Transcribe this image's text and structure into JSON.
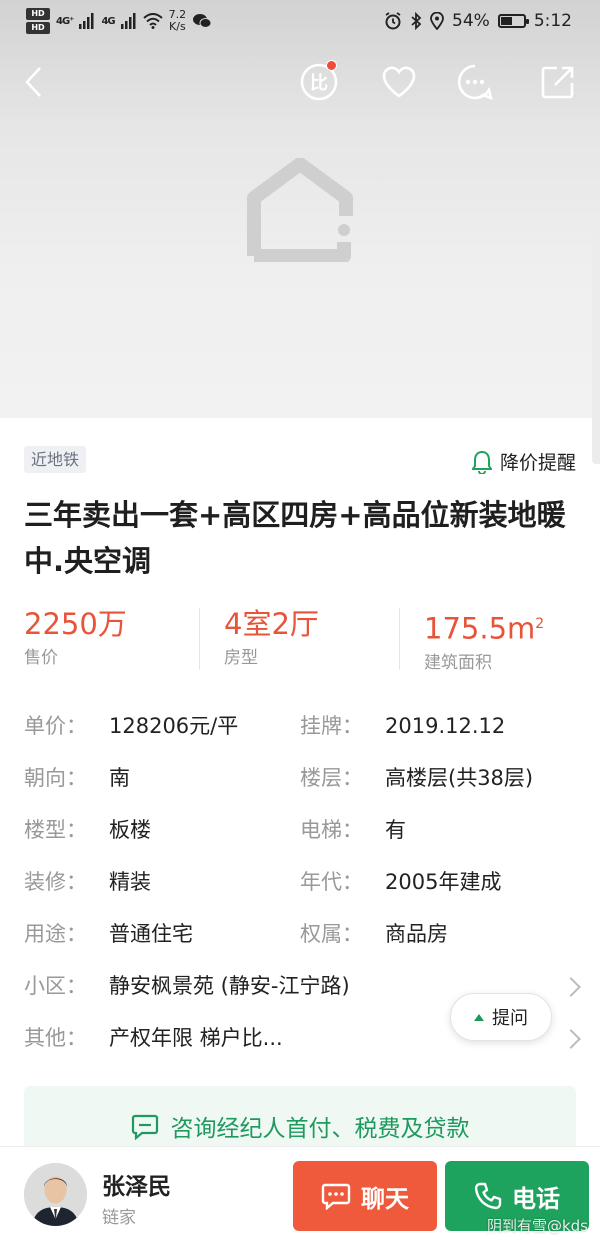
{
  "status_bar": {
    "hd_top": "HD",
    "hd_bottom": "HD",
    "signal1": "4G⁺",
    "signal2": "4G",
    "speed_value": "7.2",
    "speed_unit": "K/s",
    "battery": "54%",
    "battery_level": 0.54,
    "time": "5:12"
  },
  "nav": {
    "back_icon": "back-arrow-icon",
    "compare_icon": "compare-icon",
    "compare_glyph": "比",
    "favorite_icon": "heart-icon",
    "message_icon": "chat-bubble-icon",
    "share_icon": "share-icon"
  },
  "listing": {
    "tag": "近地铁",
    "price_alert_label": "降价提醒",
    "title": "三年卖出一套+高区四房+高品位新装地暖中.央空调"
  },
  "stats": [
    {
      "value": "2250万",
      "label": "售价"
    },
    {
      "value": "4室2厅",
      "label": "房型"
    },
    {
      "value": "175.5m",
      "sup": "2",
      "label": "建筑面积"
    }
  ],
  "details": {
    "unit_price": {
      "key": "单价：",
      "value": "128206元/平"
    },
    "listed": {
      "key": "挂牌：",
      "value": "2019.12.12"
    },
    "orientation": {
      "key": "朝向：",
      "value": "南"
    },
    "floor": {
      "key": "楼层：",
      "value": "高楼层(共38层)"
    },
    "building_type": {
      "key": "楼型：",
      "value": "板楼"
    },
    "elevator": {
      "key": "电梯：",
      "value": "有"
    },
    "decoration": {
      "key": "装修：",
      "value": "精装"
    },
    "year": {
      "key": "年代：",
      "value": "2005年建成"
    },
    "usage": {
      "key": "用途：",
      "value": "普通住宅"
    },
    "ownership": {
      "key": "权属：",
      "value": "商品房"
    },
    "community": {
      "key": "小区：",
      "value": "静安枫景苑 (静安-江宁路)"
    },
    "other": {
      "key": "其他：",
      "value": "产权年限 梯户比..."
    }
  },
  "ask_button": "提问",
  "consult_label": "咨询经纪人首付、税费及贷款",
  "agent": {
    "name": "张泽民",
    "company": "链家"
  },
  "actions": {
    "chat": "聊天",
    "call": "电话"
  },
  "watermark": "阴到有雪@kds",
  "colors": {
    "price_red": "#e8543a",
    "chat_orange": "#ef5a3c",
    "call_green": "#1ea35e",
    "consult_green": "#1f9a5e",
    "badge_red": "#f04a3a"
  }
}
